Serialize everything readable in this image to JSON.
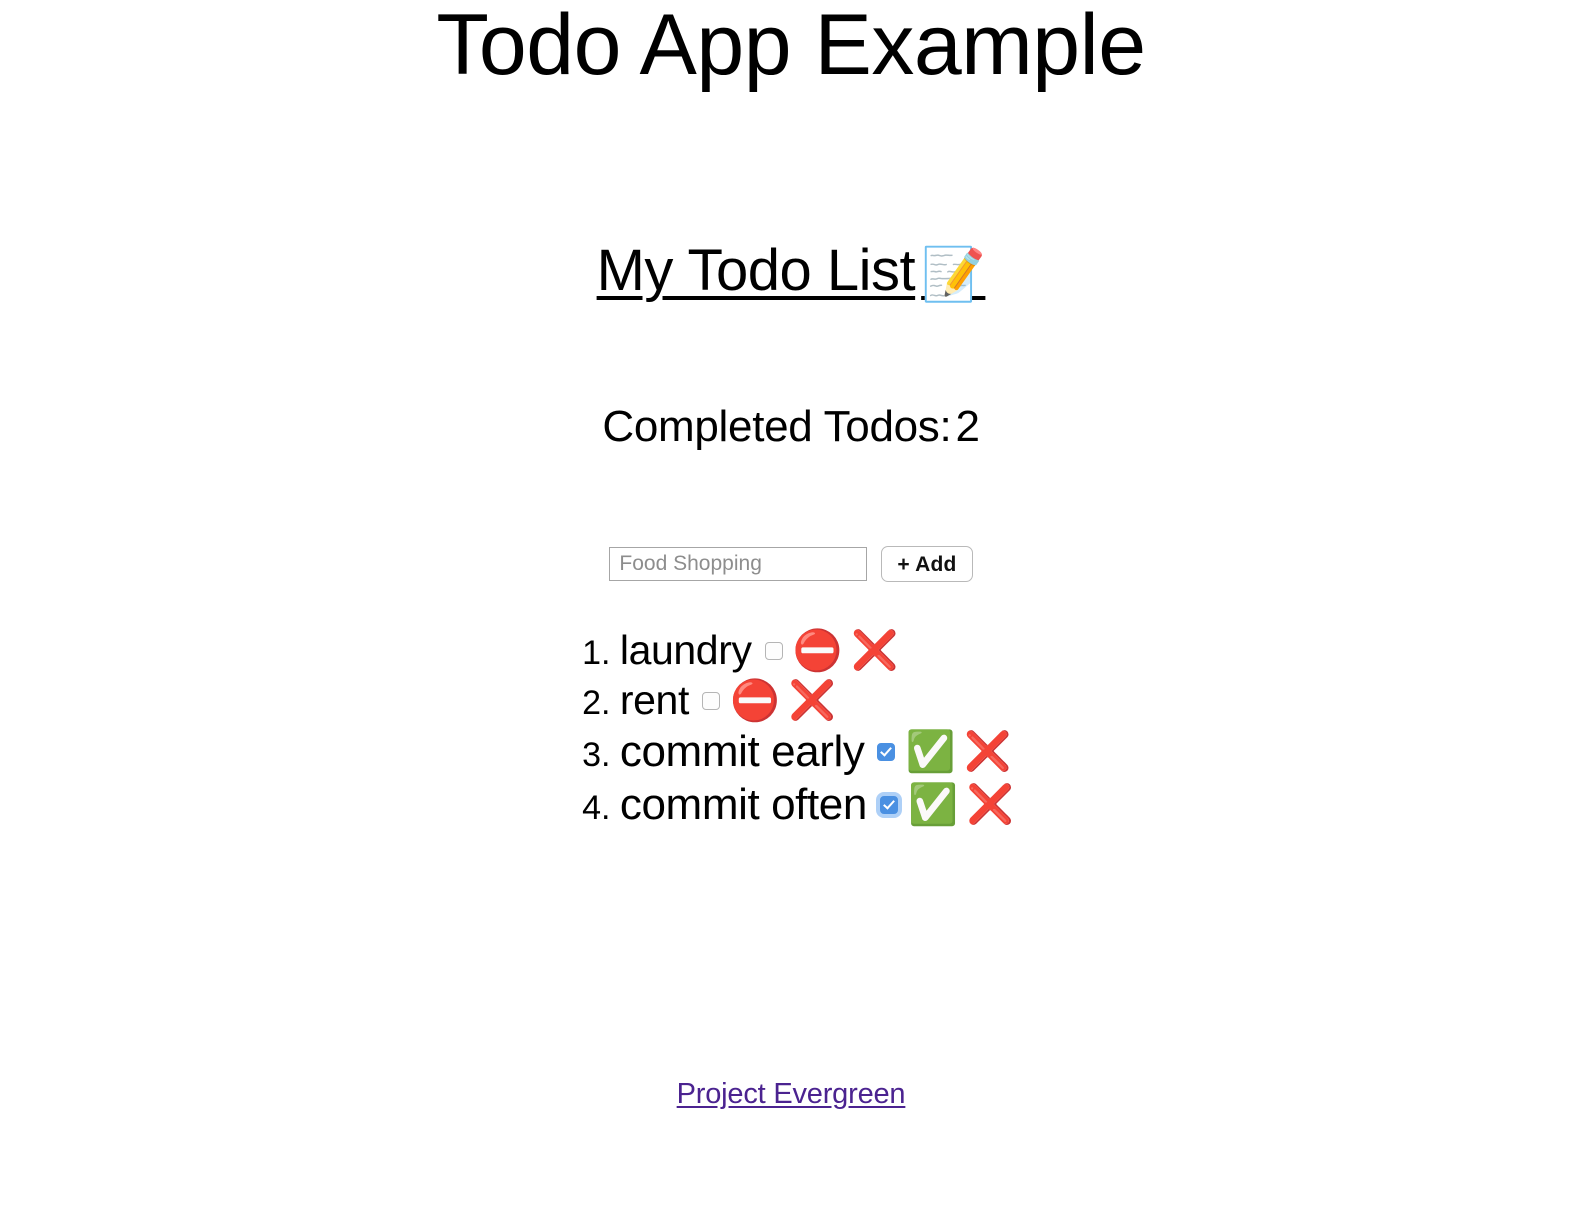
{
  "page": {
    "title": "Todo App Example",
    "background_color": "#ffffff"
  },
  "todo_widget": {
    "heading": "My Todo List",
    "heading_icon": "📝",
    "completed_label": "Completed Todos:",
    "completed_count": "2",
    "form": {
      "input_value": "",
      "input_placeholder": "Food Shopping",
      "add_label": "+ Add"
    },
    "items": [
      {
        "number": "1.",
        "text": "laundry",
        "checked": false,
        "focused": false,
        "status_icon": "⛔",
        "delete_icon": "❌"
      },
      {
        "number": "2.",
        "text": "rent",
        "checked": false,
        "focused": false,
        "status_icon": "⛔",
        "delete_icon": "❌"
      },
      {
        "number": "3.",
        "text": "commit early",
        "checked": true,
        "focused": false,
        "status_icon": "✅",
        "delete_icon": "❌"
      },
      {
        "number": "4.",
        "text": "commit often",
        "checked": true,
        "focused": true,
        "status_icon": "✅",
        "delete_icon": "❌"
      }
    ]
  },
  "footer": {
    "link_label": "Project Evergreen",
    "link_color": "#4b2390"
  }
}
